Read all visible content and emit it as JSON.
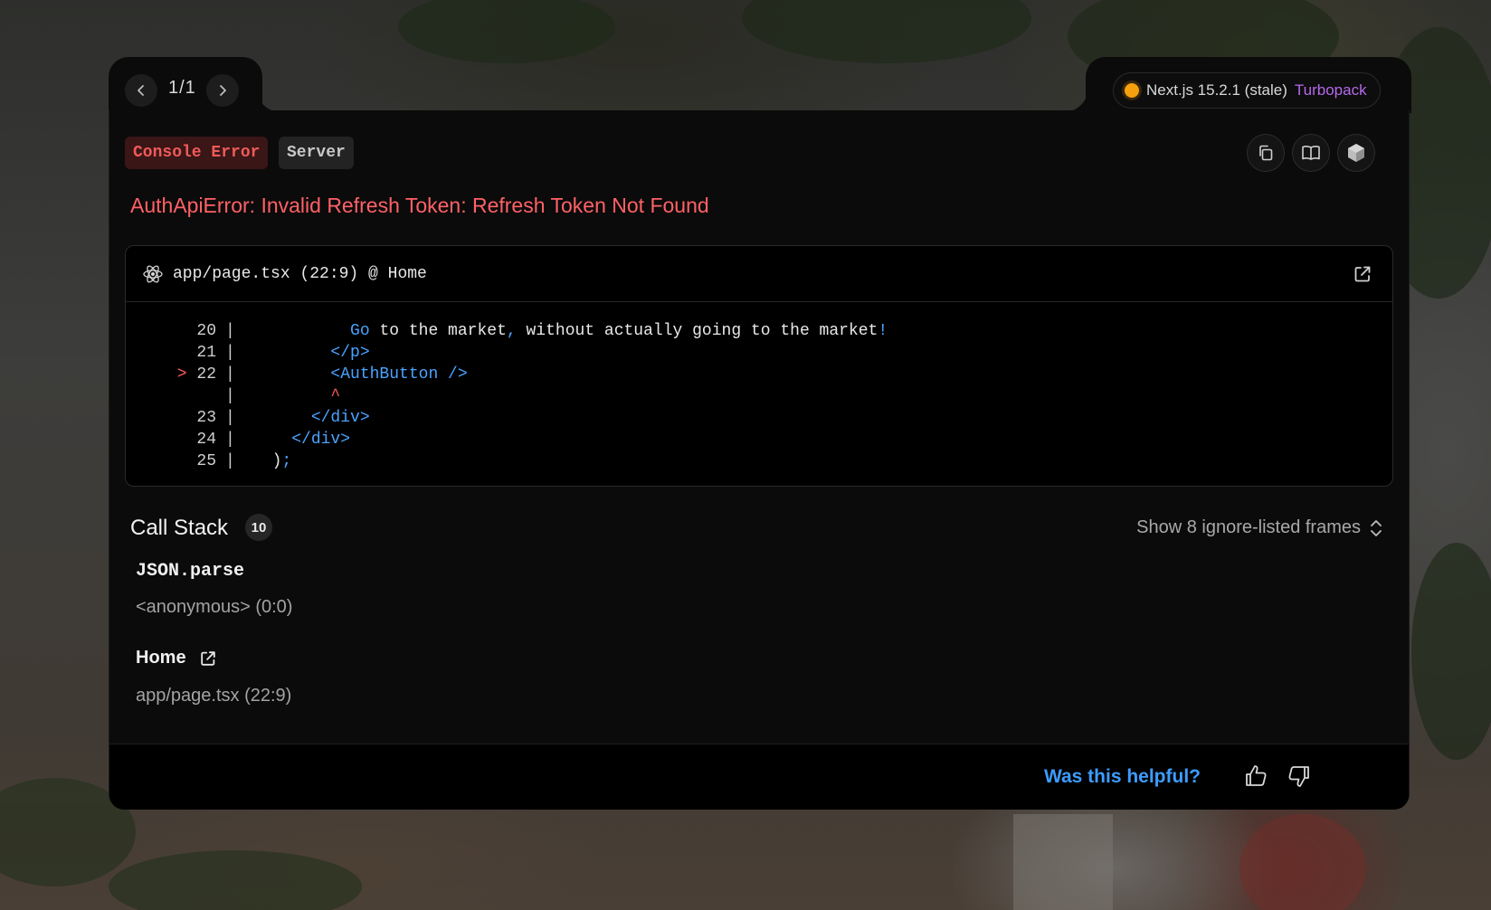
{
  "navigation": {
    "prev_icon": "chevron-left-icon",
    "next_icon": "chevron-right-icon",
    "counter": "1/1"
  },
  "version": {
    "status_color": "#f5a10d",
    "label": "Next.js 15.2.1 (stale)",
    "bundler": "Turbopack"
  },
  "badges": {
    "error": "Console Error",
    "server": "Server"
  },
  "toolbar": {
    "icons": [
      "copy-icon",
      "docs-book-icon",
      "nodejs-hexagon-icon"
    ]
  },
  "error": {
    "message": "AuthApiError: Invalid Refresh Token: Refresh Token Not Found"
  },
  "code_frame": {
    "icon": "react-icon",
    "file": "app/page.tsx (22:9) @ Home",
    "open_icon": "external-link-icon",
    "lines": [
      {
        "num": "20",
        "marker": "",
        "indent": "          ",
        "tokens": [
          {
            "t": "Go",
            "c": "blue"
          },
          {
            "t": " to the market",
            "c": "white"
          },
          {
            "t": ",",
            "c": "blue"
          },
          {
            "t": " without actually going to the market",
            "c": "white"
          },
          {
            "t": "!",
            "c": "blue"
          }
        ]
      },
      {
        "num": "21",
        "marker": "",
        "indent": "        ",
        "tokens": [
          {
            "t": "</p>",
            "c": "blue"
          }
        ]
      },
      {
        "num": "22",
        "marker": ">",
        "indent": "        ",
        "tokens": [
          {
            "t": "<AuthButton />",
            "c": "blue"
          }
        ]
      },
      {
        "num": "",
        "marker": "",
        "indent": "        ",
        "tokens": [
          {
            "t": "^",
            "c": "red"
          }
        ]
      },
      {
        "num": "23",
        "marker": "",
        "indent": "      ",
        "tokens": [
          {
            "t": "</div>",
            "c": "blue"
          }
        ]
      },
      {
        "num": "24",
        "marker": "",
        "indent": "    ",
        "tokens": [
          {
            "t": "</div>",
            "c": "blue"
          }
        ]
      },
      {
        "num": "25",
        "marker": "",
        "indent": "  ",
        "tokens": [
          {
            "t": ")",
            "c": "white"
          },
          {
            "t": ";",
            "c": "blue"
          }
        ]
      }
    ]
  },
  "call_stack": {
    "title": "Call Stack",
    "count": "10",
    "toggle": "Show 8 ignore-listed frames",
    "toggle_icon": "chevron-up-down-icon",
    "frames": [
      {
        "fn": "JSON.parse",
        "location": "<anonymous> (0:0)"
      },
      {
        "fn": "Home",
        "location": "app/page.tsx (22:9)",
        "icon": "external-link-icon"
      }
    ]
  },
  "footer": {
    "question": "Was this helpful?",
    "up_icon": "thumbs-up-icon",
    "down_icon": "thumbs-down-icon"
  }
}
